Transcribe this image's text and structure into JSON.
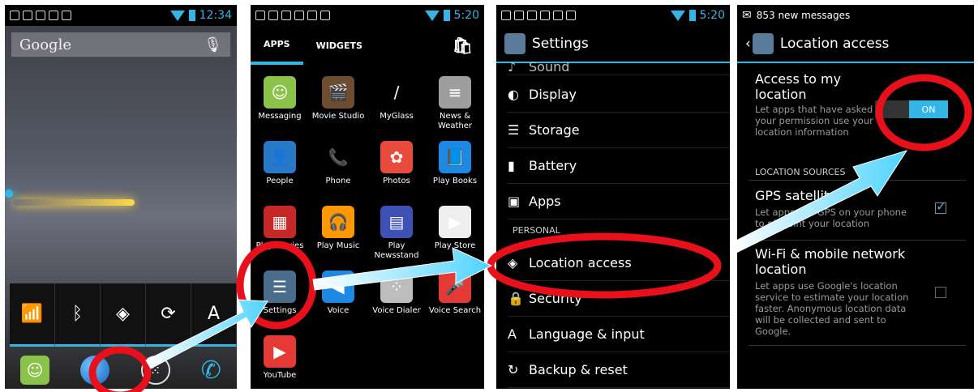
{
  "panel1": {
    "status_time": "12:34",
    "search_label": "Google",
    "mic_icon": "mic-icon",
    "quick_settings": [
      "wifi-icon",
      "bluetooth-icon",
      "gps-icon",
      "sync-icon",
      "auto-rotate-icon"
    ],
    "dock": [
      "messaging-icon",
      "browser-icon",
      "apps-launcher-icon",
      "phone-icon"
    ]
  },
  "panel2": {
    "status_time": "5:20",
    "tabs": [
      {
        "label": "APPS"
      },
      {
        "label": "WIDGETS"
      }
    ],
    "apps": [
      {
        "label": "Messaging",
        "color": "#8bc34a",
        "glyph": "☺"
      },
      {
        "label": "Movie Studio",
        "color": "#6d4c2f",
        "glyph": "🎬"
      },
      {
        "label": "MyGlass",
        "color": "#000000",
        "glyph": "/"
      },
      {
        "label": "News & Weather",
        "color": "#9e9e9e",
        "glyph": "≡"
      },
      {
        "label": "People",
        "color": "#2979c9",
        "glyph": "👤"
      },
      {
        "label": "Phone",
        "color": "#000000",
        "glyph": "📞"
      },
      {
        "label": "Photos",
        "color": "#e84a3c",
        "glyph": "✿"
      },
      {
        "label": "Play Books",
        "color": "#1e88e5",
        "glyph": "📘"
      },
      {
        "label": "Play Movies",
        "color": "#c62828",
        "glyph": "▦"
      },
      {
        "label": "Play Music",
        "color": "#ff9800",
        "glyph": "🎧"
      },
      {
        "label": "Play Newsstand",
        "color": "#3f51b5",
        "glyph": "▤"
      },
      {
        "label": "Play Store",
        "color": "#eeeeee",
        "glyph": "▶"
      },
      {
        "label": "Settings",
        "color": "#4a6d8c",
        "glyph": "☰"
      },
      {
        "label": "Voice",
        "color": "#1e88e5",
        "glyph": "◀"
      },
      {
        "label": "Voice Dialer",
        "color": "#bdbdbd",
        "glyph": "⁘"
      },
      {
        "label": "Voice Search",
        "color": "#e53935",
        "glyph": "🎤"
      },
      {
        "label": "YouTube",
        "color": "#e53935",
        "glyph": "▶"
      }
    ]
  },
  "panel3": {
    "status_time": "5:20",
    "title": "Settings",
    "cut_row": "Sound",
    "rows_top": [
      {
        "icon": "display-icon",
        "glyph": "◐",
        "label": "Display"
      },
      {
        "icon": "storage-icon",
        "glyph": "☰",
        "label": "Storage"
      },
      {
        "icon": "battery-icon",
        "glyph": "▮",
        "label": "Battery"
      },
      {
        "icon": "apps-icon",
        "glyph": "▣",
        "label": "Apps"
      }
    ],
    "section": "PERSONAL",
    "rows_bottom": [
      {
        "icon": "location-icon",
        "glyph": "◈",
        "label": "Location access"
      },
      {
        "icon": "lock-icon",
        "glyph": "🔒",
        "label": "Security"
      },
      {
        "icon": "language-icon",
        "glyph": "A",
        "label": "Language & input"
      },
      {
        "icon": "backup-icon",
        "glyph": "↻",
        "label": "Backup & reset"
      }
    ]
  },
  "panel4": {
    "status_text": "853 new messages",
    "title": "Location access",
    "access_title": "Access to my location",
    "access_desc": "Let apps that have asked your permission use your location information",
    "switch_label": "ON",
    "section": "LOCATION SOURCES",
    "gps_title": "GPS satellites",
    "gps_desc": "Let apps use GPS on your phone to pinpoint your location",
    "gps_checked": true,
    "wifi_title": "Wi-Fi & mobile network location",
    "wifi_desc": "Let apps use Google's location service to estimate your location faster. Anonymous location data will be collected and sent to Google.",
    "wifi_checked": false
  },
  "colors": {
    "accent": "#33b5e5",
    "highlight": "#e8101a",
    "arrow": "#4fd3ff"
  }
}
